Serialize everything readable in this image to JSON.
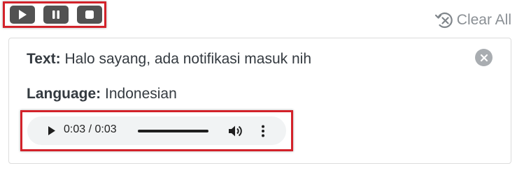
{
  "controls": {
    "play": "play-icon",
    "pause": "pause-icon",
    "stop": "stop-icon",
    "highlight_color": "#d3222a"
  },
  "clear_all": {
    "label": "Clear All",
    "icon": "history-clear-icon"
  },
  "entry": {
    "text_label": "Text:",
    "text_value": "Halo sayang, ada notifikasi masuk nih",
    "language_label": "Language:",
    "language_value": "Indonesian",
    "close_icon": "close-circle-icon"
  },
  "audio": {
    "time": "0:03 / 0:03",
    "progress": 1.0,
    "play_icon": "play-icon",
    "volume_icon": "volume-icon",
    "menu_icon": "more-vert-icon"
  }
}
